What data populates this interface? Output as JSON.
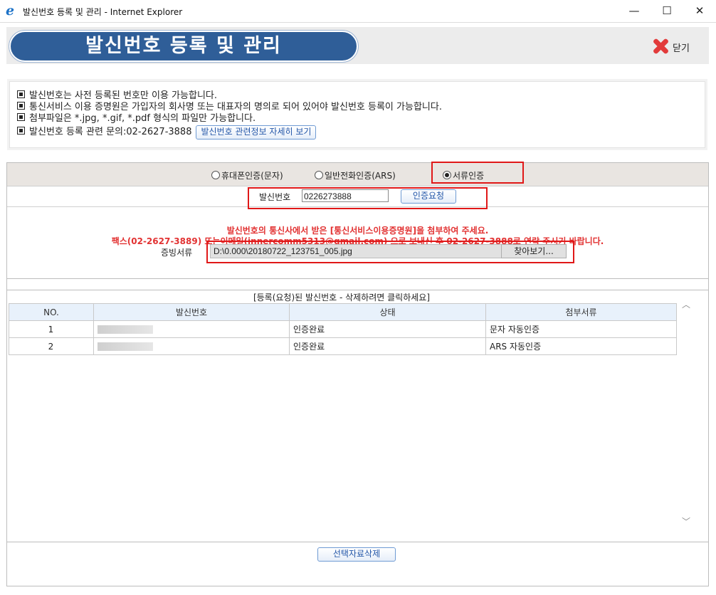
{
  "window": {
    "title": "발신번호 등록 및 관리 - Internet Explorer",
    "minimize": "—",
    "maximize": "☐",
    "close": "✕"
  },
  "header": {
    "title": "발신번호 등록 및 관리",
    "close_label": "닫기"
  },
  "notices": [
    "발신번호는 사전 등록된 번호만 이용 가능합니다.",
    "통신서비스 이용 증명원은 가입자의 회사명 또는 대표자의 명의로 되어 있어야 발신번호 등록이 가능합니다.",
    "첨부파일은 *.jpg, *.gif, *.pdf 형식의 파일만 가능합니다.",
    "발신번호 등록 관련 문의:02-2627-3888"
  ],
  "notice_button": "발신번호 관련정보 자세히 보기",
  "auth": {
    "options": [
      "휴대폰인증(문자)",
      "일반전화인증(ARS)",
      "서류인증"
    ],
    "selected": 2
  },
  "sender": {
    "label": "발신번호",
    "value": "0226273888",
    "request_button": "인증요청"
  },
  "instructions": [
    "발신번호의 통신사에서 받은 [통신서비스이용증명원]을 첨부하여 주세요.",
    "팩스(02-2627-3889) 또는이메일(innercomm5313@gmail.com) 으로 보내신 후 02-2627-3888로 연락 주시기 바랍니다."
  ],
  "file": {
    "label": "증빙서류",
    "value": "D:\\0.000\\20180722_123751_005.jpg",
    "browse_button": "찾아보기..."
  },
  "registered": {
    "title": "[등록(요청)된 발신번호 - 삭제하려면 클릭하세요]",
    "columns": [
      "NO.",
      "발신번호",
      "상태",
      "첨부서류"
    ],
    "rows": [
      {
        "no": "1",
        "status": "인증완료",
        "attachment": "문자 자동인증"
      },
      {
        "no": "2",
        "status": "인증완료",
        "attachment": "ARS 자동인증"
      }
    ]
  },
  "scroll": {
    "up": "︿",
    "down": "﹀"
  },
  "delete_button": "선택자료삭제"
}
